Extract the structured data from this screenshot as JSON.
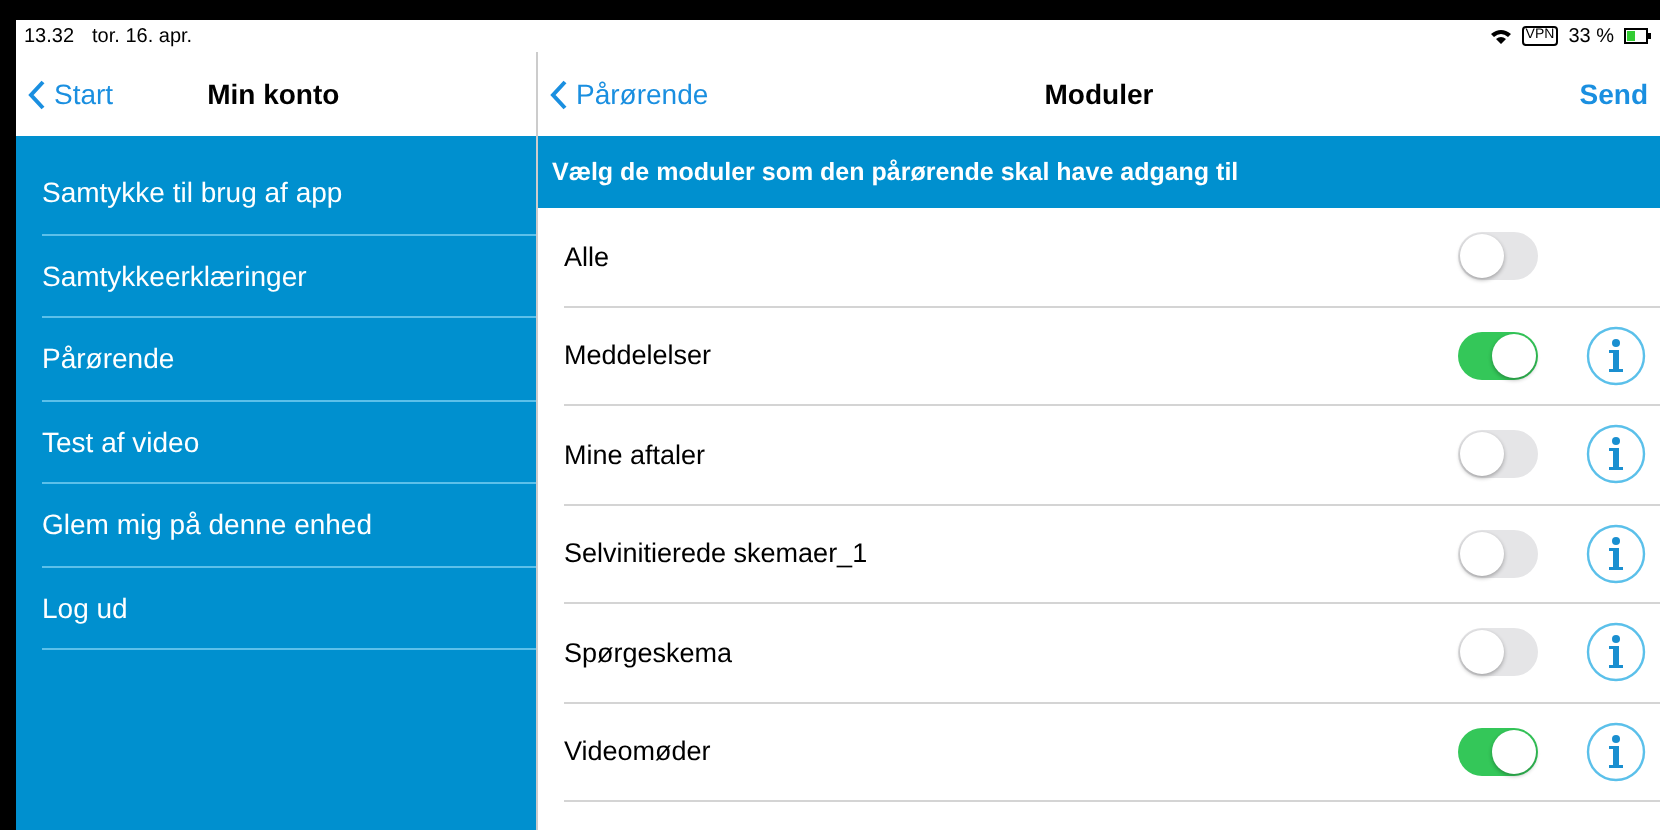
{
  "status_bar": {
    "time": "13.32",
    "date": "tor. 16. apr.",
    "vpn": "VPN",
    "battery": "33 %"
  },
  "sidebar": {
    "back": "Start",
    "title": "Min konto",
    "items": [
      {
        "label": "Samtykke til brug af app"
      },
      {
        "label": "Samtykkeerklæringer"
      },
      {
        "label": "Pårørende"
      },
      {
        "label": "Test af video"
      },
      {
        "label": "Glem mig på denne enhed"
      },
      {
        "label": "Log ud"
      }
    ]
  },
  "main": {
    "back": "Pårørende",
    "title": "Moduler",
    "action": "Send",
    "header": "Vælg de moduler som den pårørende skal have adgang til",
    "modules": [
      {
        "label": "Alle",
        "on": false,
        "info": false
      },
      {
        "label": "Meddelelser",
        "on": true,
        "info": true
      },
      {
        "label": "Mine aftaler",
        "on": false,
        "info": true
      },
      {
        "label": "Selvinitierede skemaer_1",
        "on": false,
        "info": true
      },
      {
        "label": "Spørgeskema",
        "on": false,
        "info": true
      },
      {
        "label": "Videomøder",
        "on": true,
        "info": true
      }
    ]
  }
}
